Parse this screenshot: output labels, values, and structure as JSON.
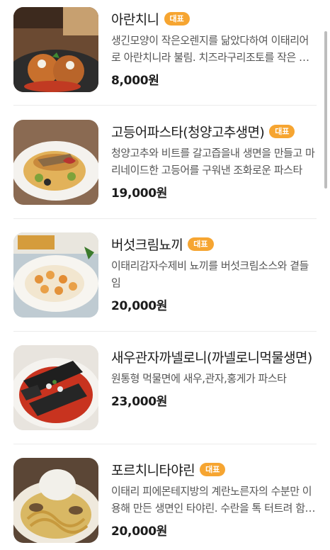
{
  "menu": {
    "items": [
      {
        "name": "아란치니",
        "badge": "대표",
        "description": "생긴모양이 작은오렌지를 닮았다하여 이태리어로 아란치니라 불림. 치즈라구리조토를 작은 공모양으로 튀겨낸 요리",
        "price": "8,000원"
      },
      {
        "name": "고등어파스타(청양고추생면)",
        "badge": "대표",
        "description": "청양고추와 비트를 갈고즙을내 생면을 만들고 마리네이드한 고등어를 구워낸 조화로운 파스타",
        "price": "19,000원"
      },
      {
        "name": "버섯크림뇨끼",
        "badge": "대표",
        "description": "이태리감자수제비 뇨끼를 버섯크림소스와 곁들임",
        "price": "20,000원"
      },
      {
        "name": "새우관자까넬로니(까넬로니먹물생면)",
        "badge": "",
        "description": "원통형 먹물면에 새우,관자,홍게가 파스타",
        "price": "23,000원"
      },
      {
        "name": "포르치니타야린",
        "badge": "대표",
        "description": "이태리 피에몬테지방의 계란노른자의 수분만 이용해 만든 생면인 타야린. 수란을 톡 터트려 함께 드세요",
        "price": "20,000원"
      }
    ]
  },
  "icons": {
    "thumb_0": "arancini-photo",
    "thumb_1": "mackerel-pasta-photo",
    "thumb_2": "gnocchi-photo",
    "thumb_3": "cannelloni-photo",
    "thumb_4": "tajarin-photo"
  },
  "colors": {
    "badge": "#f6a531",
    "price": "#1c1c1c",
    "description": "#555555",
    "divider": "#ececec"
  }
}
